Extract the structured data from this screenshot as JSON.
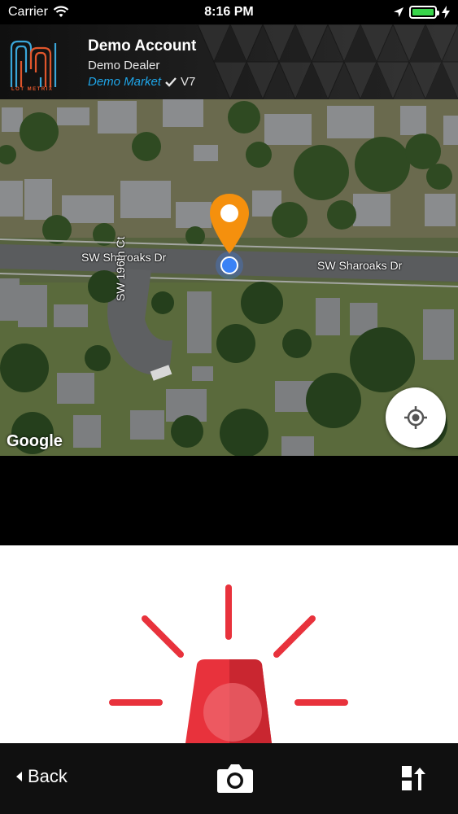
{
  "status_bar": {
    "carrier": "Carrier",
    "time": "8:16 PM",
    "battery_level": 1.0,
    "icons": [
      "wifi-icon",
      "location-arrow-icon",
      "battery-icon",
      "charging-bolt-icon"
    ]
  },
  "header": {
    "logo_text": "LOT METRIX",
    "account_name": "Demo Account",
    "dealer_name": "Demo Dealer",
    "market_name": "Demo Market",
    "version": "V7",
    "colors": {
      "market": "#1ea5e8",
      "logo_blue": "#3aa6d9",
      "logo_orange": "#e0562c"
    }
  },
  "map": {
    "road_labels": {
      "sharoaks_left": "SW Sharoaks Dr",
      "sharoaks_right": "SW Sharoaks Dr",
      "court": "SW 196th Ct"
    },
    "attribution": "Google",
    "pin_color": "#f5900d",
    "dot_color": "#3b82f6",
    "locate_icon": "crosshair-icon"
  },
  "alert": {
    "icon": "siren-icon",
    "color": "#e8323c"
  },
  "toolbar": {
    "back_label": "Back",
    "camera_icon": "camera-icon",
    "share_icon": "share-upload-icon"
  }
}
